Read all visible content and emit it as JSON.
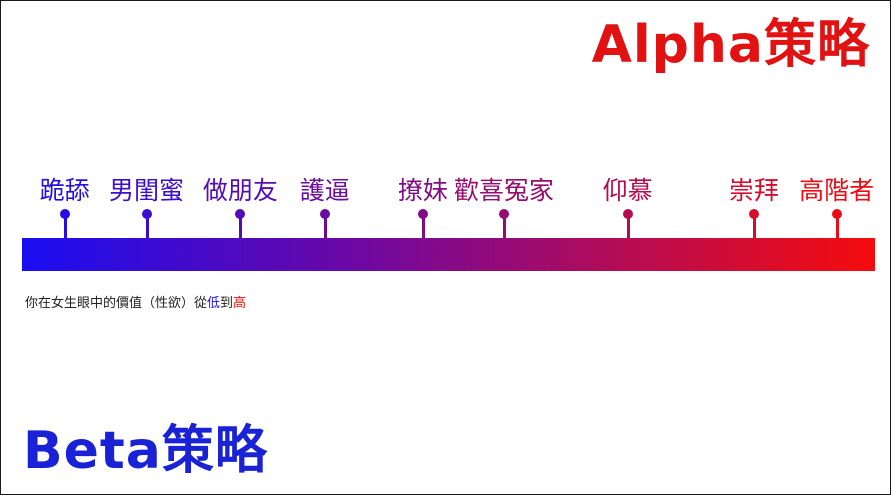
{
  "alpha_title": "Alpha策略",
  "beta_title": "Beta策略",
  "colors": {
    "low": "#1a0df2",
    "high": "#f50c0c",
    "alpha_title": "#e11212",
    "beta_title": "#1a22d6",
    "caption_text": "#222222"
  },
  "scale": {
    "labels": [
      "跪舔",
      "男閨蜜",
      "做朋友",
      "護逼",
      "撩妹",
      "歡喜冤家",
      "仰慕",
      "崇拜",
      "高階者"
    ],
    "values": [
      0.05,
      0.146,
      0.256,
      0.355,
      0.47,
      0.565,
      0.71,
      0.858,
      0.955
    ]
  },
  "caption": {
    "prefix": "你在女生眼中的價值（性欲）從",
    "low": "低",
    "middle": "到",
    "high": "高"
  }
}
